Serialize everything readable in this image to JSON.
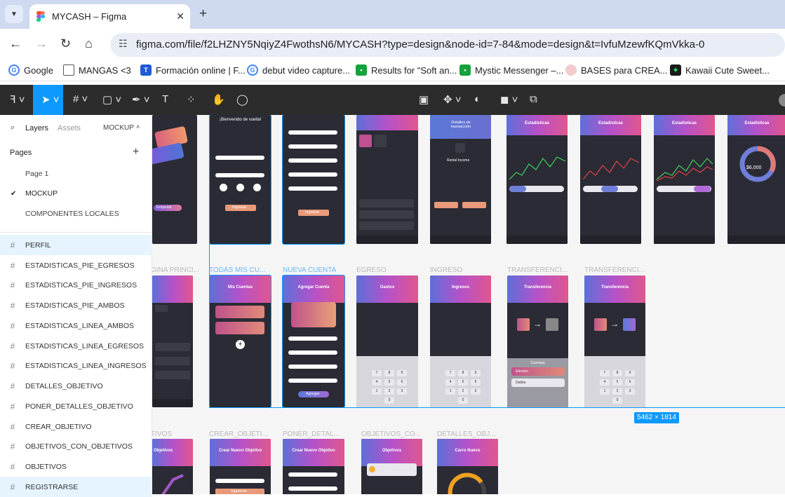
{
  "browser": {
    "tab_title": "MYCASH – Figma",
    "url": "figma.com/file/f2LHZNY5NqiyZ4FwothsN6/MYCASH?type=design&node-id=7-84&mode=design&t=IvfuMzewfKQmVkka-0",
    "bookmarks": [
      {
        "label": "Google",
        "icon": "google-icon",
        "color": "#4285f4"
      },
      {
        "label": "MANGAS <3",
        "icon": "folder-icon",
        "color": "#666666"
      },
      {
        "label": "Formación online | F...",
        "icon": "bookmark-icon",
        "color": "#1e5bd6"
      },
      {
        "label": "debut video capture...",
        "icon": "google-icon",
        "color": "#4285f4"
      },
      {
        "label": "Results for \"Soft an...",
        "icon": "bookmark-icon",
        "color": "#14a23c"
      },
      {
        "label": "Mystic Messenger –...",
        "icon": "bookmark-icon",
        "color": "#14a23c"
      },
      {
        "label": "BASES para CREA...",
        "icon": "bookmark-icon",
        "color": "#e8a0a0"
      },
      {
        "label": "Kawaii Cute Sweet...",
        "icon": "bookmark-icon",
        "color": "#1a1a1a"
      }
    ]
  },
  "sidebar": {
    "tabs": {
      "layers": "Layers",
      "assets": "Assets",
      "page_selector": "MOCKUP"
    },
    "pages_heading": "Pages",
    "pages": [
      {
        "label": "Page 1",
        "current": false
      },
      {
        "label": "MOCKUP",
        "current": true
      },
      {
        "label": "COMPONENTES LOCALES",
        "current": false
      }
    ],
    "layers": [
      {
        "label": "PERFIL",
        "selected": true
      },
      {
        "label": "ESTADISTICAS_PIE_EGRESOS",
        "selected": false
      },
      {
        "label": "ESTADISTICAS_PIE_INGRESOS",
        "selected": false
      },
      {
        "label": "ESTADISTICAS_PIE_AMBOS",
        "selected": false
      },
      {
        "label": "ESTADISTICAS_LINEA_AMBOS",
        "selected": false
      },
      {
        "label": "ESTADISTICAS_LINEA_EGRESOS",
        "selected": false
      },
      {
        "label": "ESTADISTICAS_LINEA_INGRESOS",
        "selected": false
      },
      {
        "label": "DETALLES_OBJETIVO",
        "selected": false
      },
      {
        "label": "PONER_DETALLES_OBJETIVO",
        "selected": false
      },
      {
        "label": "CREAR_OBJETIVO",
        "selected": false
      },
      {
        "label": "OBJETIVOS_CON_OBJETIVOS",
        "selected": false
      },
      {
        "label": "OBJETIVOS",
        "selected": false
      },
      {
        "label": "REGISTRARSE",
        "selected": true
      }
    ]
  },
  "canvas": {
    "selection_size": "5462 × 1814",
    "frame_labels": {
      "pagina_principal": "GINA PRINCI...",
      "todas_mis_cuentas": "TODAS MIS CU...",
      "nueva_cuenta": "NUEVA CUENTA",
      "egreso": "EGRESO",
      "ingreso": "INGRESO",
      "transferencia_1": "TRANSFERENCI...",
      "transferencia_2": "TRANSFERENCI...",
      "objetivos": "TIVOS",
      "crear_objetivo": "CREAR_OBJETI...",
      "poner_detalles": "PONER_DETAL...",
      "objetivos_con": "OBJETIVOS_CO...",
      "detalles_objetivo": "DETALLES_OBJ..."
    },
    "screens": {
      "bienvenido": "¡Bienvenido de vuelta!",
      "empezar": "Empezar",
      "ingresar": "Ingresar",
      "estadisticas": "Estadísticas",
      "detalles_transaccion": "Detalles de transacción",
      "rental_income": "Rental Income",
      "mis_cuentas": "Mis Cuentas",
      "agregar_cuenta": "Agregar Cuenta",
      "agregar": "Agregar",
      "gastos": "Gastos",
      "ingresos": "Ingresos",
      "transferencia": "Transferencia",
      "cuentas": "Cuentas",
      "efectivo": "Efectivo",
      "debito": "Debito",
      "crear_nuevo_objetivo": "Crear Nuevo Objetivo",
      "siguiente": "Siguiente",
      "objetivos": "Objetivos",
      "carro_nuevo": "Carro Nuevo",
      "total_saldo": "$6,000",
      "ingresos_tab": "Ingresos",
      "egresos_tab": "Egresos",
      "ambos_tab": "Ambos"
    }
  }
}
